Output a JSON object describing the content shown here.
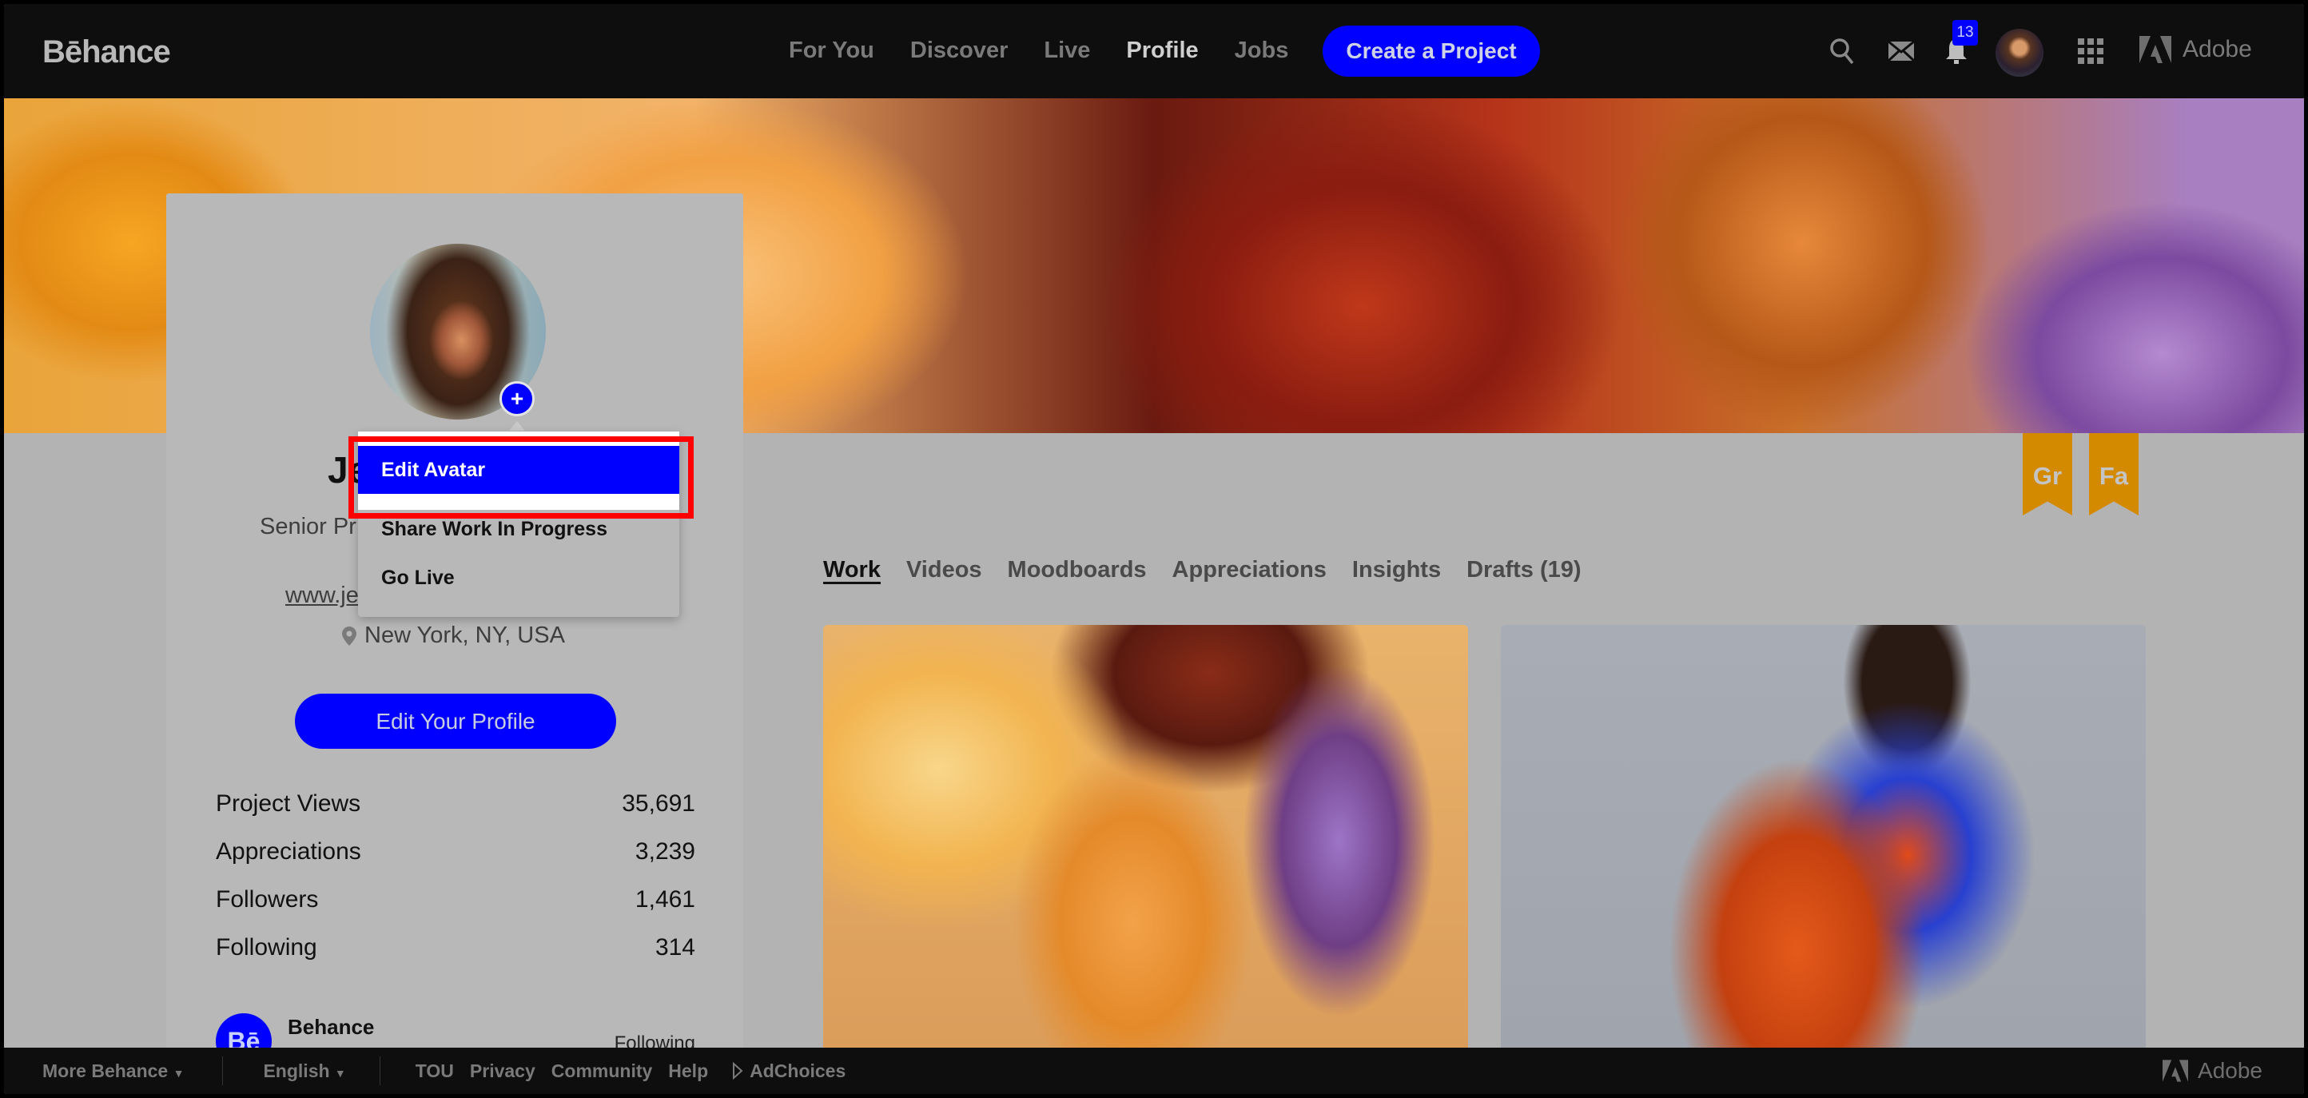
{
  "header": {
    "logo": "Bēhance",
    "nav": [
      {
        "label": "For You",
        "active": false
      },
      {
        "label": "Discover",
        "active": false
      },
      {
        "label": "Live",
        "active": false
      },
      {
        "label": "Profile",
        "active": true
      },
      {
        "label": "Jobs",
        "active": false
      }
    ],
    "create_label": "Create a Project",
    "icons": [
      "search-icon",
      "mail-icon",
      "bell-icon",
      "avatar",
      "apps-grid-icon",
      "adobe-logo"
    ],
    "notification_count": "13",
    "adobe_label": "Adobe"
  },
  "profile": {
    "name": "Je",
    "title": "Senior Pr",
    "website": "www.je",
    "location": "New York, NY, USA",
    "edit_profile_label": "Edit Your Profile",
    "stats": [
      {
        "label": "Project Views",
        "value": "35,691"
      },
      {
        "label": "Appreciations",
        "value": "3,239"
      },
      {
        "label": "Followers",
        "value": "1,461"
      },
      {
        "label": "Following",
        "value": "314"
      }
    ],
    "following": {
      "badge": "Bē",
      "name": "Behance",
      "status": "Following"
    }
  },
  "avatar_menu": {
    "items": [
      {
        "label": "Edit Avatar",
        "highlighted": true
      },
      {
        "label": "Share Work In Progress",
        "highlighted": false
      },
      {
        "label": "Go Live",
        "highlighted": false
      }
    ]
  },
  "badges": [
    "Gr",
    "Fa"
  ],
  "tabs": [
    {
      "label": "Work",
      "active": true
    },
    {
      "label": "Videos",
      "active": false
    },
    {
      "label": "Moodboards",
      "active": false
    },
    {
      "label": "Appreciations",
      "active": false
    },
    {
      "label": "Insights",
      "active": false
    },
    {
      "label": "Drafts (19)",
      "active": false
    }
  ],
  "footer": {
    "more_label": "More Behance",
    "language": "English",
    "links": [
      "TOU",
      "Privacy",
      "Community",
      "Help"
    ],
    "adchoices": "AdChoices",
    "adobe_label": "Adobe"
  },
  "colors": {
    "accent": "#0000ff",
    "highlight_box": "#ff0000",
    "badge": "#d48a00"
  }
}
